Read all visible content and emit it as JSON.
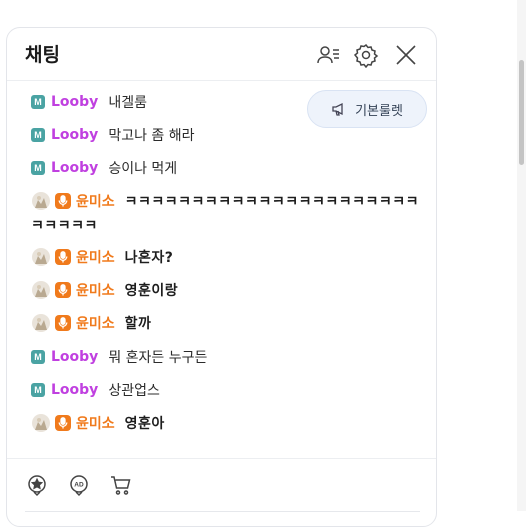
{
  "header": {
    "title": "채팅",
    "icons": [
      "user-list-icon",
      "gear-icon",
      "close-icon"
    ]
  },
  "roulette_button": {
    "label": "기본룰렛",
    "icon": "megaphone-icon"
  },
  "colors": {
    "looby_nick": "#c040e0",
    "yoon_nick": "#f07a1c",
    "m_badge": "#4aa3a3",
    "mic_badge": "#f07a1c"
  },
  "messages": [
    {
      "user": "Looby",
      "badge": "M",
      "text": "내겔룸"
    },
    {
      "user": "Looby",
      "badge": "M",
      "text": "막고나 좀 해라"
    },
    {
      "user": "Looby",
      "badge": "M",
      "text": "승이나 먹게"
    },
    {
      "user": "윤미소",
      "badge": "mic",
      "text": "ㅋㅋㅋㅋㅋㅋㅋㅋㅋㅋㅋㅋㅋㅋㅋㅋㅋㅋㅋㅋㅋㅋ",
      "text_wrap": "ㅋㅋㅋㅋㅋ"
    },
    {
      "user": "윤미소",
      "badge": "mic",
      "text": "나혼자?"
    },
    {
      "user": "윤미소",
      "badge": "mic",
      "text": "영훈이랑"
    },
    {
      "user": "윤미소",
      "badge": "mic",
      "text": "할까"
    },
    {
      "user": "Looby",
      "badge": "M",
      "text": "뭐 혼자든 누구든"
    },
    {
      "user": "Looby",
      "badge": "M",
      "text": "상관업스"
    },
    {
      "user": "윤미소",
      "badge": "mic",
      "text": "영훈아"
    }
  ],
  "footer": {
    "icons": [
      "star-badge-icon",
      "ad-balloon-icon",
      "cart-icon"
    ]
  },
  "badges": {
    "m_label": "M"
  }
}
